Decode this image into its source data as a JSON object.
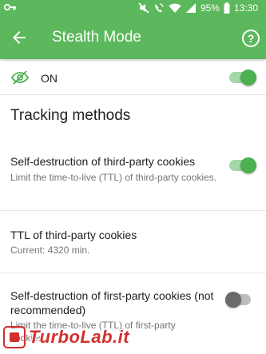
{
  "status_bar": {
    "battery": "95%",
    "time": "13:30",
    "icons": [
      "key-icon",
      "mute-icon",
      "wifi-call-icon",
      "wifi-icon",
      "signal-icon",
      "battery-icon"
    ]
  },
  "app_bar": {
    "title": "Stealth Mode",
    "back_icon": "arrow-back-icon",
    "help_label": "?"
  },
  "master": {
    "icon": "eye-off-icon",
    "label": "ON",
    "enabled": true
  },
  "section_title": "Tracking methods",
  "settings": [
    {
      "title": "Self-destruction of third-party cookies",
      "subtitle": "Limit the time-to-live (TTL) of third-party cookies.",
      "enabled": true
    },
    {
      "title": "TTL of third-party cookies",
      "subtitle": "Current: 4320 min."
    },
    {
      "title": "Self-destruction of first-party cookies (not recommended)",
      "subtitle": "Limit the time-to-live (TTL) of first-party cookies.",
      "enabled": false
    }
  ],
  "watermark": "TurboLab.it",
  "colors": {
    "toolbar": "#5cb85c",
    "toggle_on": "#4caf50",
    "toggle_track_on": "#a5d6a7"
  }
}
